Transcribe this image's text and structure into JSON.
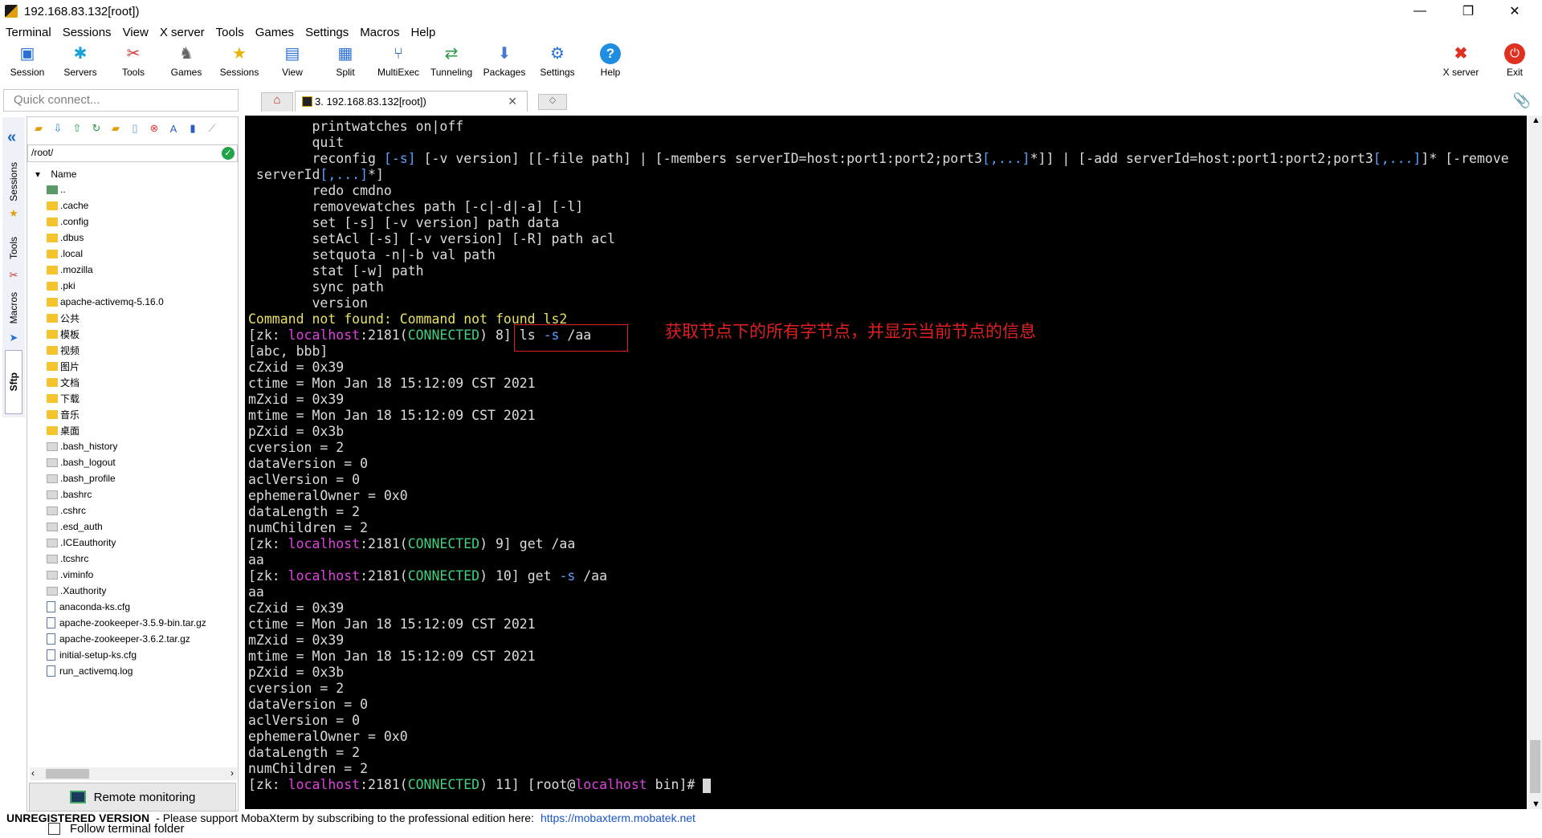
{
  "window": {
    "title": "192.168.83.132[root])",
    "controls": {
      "minimize": "—",
      "restore": "❐",
      "close": "✕"
    }
  },
  "menu": [
    "Terminal",
    "Sessions",
    "View",
    "X server",
    "Tools",
    "Games",
    "Settings",
    "Macros",
    "Help"
  ],
  "toolbar": {
    "items": [
      {
        "label": "Session",
        "icon": "session-icon"
      },
      {
        "label": "Servers",
        "icon": "servers-icon"
      },
      {
        "label": "Tools",
        "icon": "tools-icon"
      },
      {
        "label": "Games",
        "icon": "games-icon"
      },
      {
        "label": "Sessions",
        "icon": "star-icon"
      },
      {
        "label": "View",
        "icon": "view-icon"
      },
      {
        "label": "Split",
        "icon": "split-icon"
      },
      {
        "label": "MultiExec",
        "icon": "multiexec-icon"
      },
      {
        "label": "Tunneling",
        "icon": "tunneling-icon"
      },
      {
        "label": "Packages",
        "icon": "packages-icon"
      },
      {
        "label": "Settings",
        "icon": "settings-icon"
      },
      {
        "label": "Help",
        "icon": "help-icon"
      }
    ],
    "xserver": "X server",
    "exit": "Exit"
  },
  "quick_connect": {
    "placeholder": "Quick connect..."
  },
  "tabs": {
    "active": "3. 192.168.83.132[root])"
  },
  "side_tabs": [
    "Sessions",
    "Tools",
    "Macros",
    "Sftp"
  ],
  "sftp": {
    "path": "/root/",
    "column": "Name",
    "items": [
      {
        "name": "..",
        "type": "up"
      },
      {
        "name": ".cache",
        "type": "folder"
      },
      {
        "name": ".config",
        "type": "folder"
      },
      {
        "name": ".dbus",
        "type": "folder"
      },
      {
        "name": ".local",
        "type": "folder"
      },
      {
        "name": ".mozilla",
        "type": "folder"
      },
      {
        "name": ".pki",
        "type": "folder"
      },
      {
        "name": "apache-activemq-5.16.0",
        "type": "folder"
      },
      {
        "name": "公共",
        "type": "folder"
      },
      {
        "name": "模板",
        "type": "folder"
      },
      {
        "name": "视频",
        "type": "folder"
      },
      {
        "name": "图片",
        "type": "folder"
      },
      {
        "name": "文档",
        "type": "folder"
      },
      {
        "name": "下载",
        "type": "folder"
      },
      {
        "name": "音乐",
        "type": "folder"
      },
      {
        "name": "桌面",
        "type": "folder"
      },
      {
        "name": ".bash_history",
        "type": "file"
      },
      {
        "name": ".bash_logout",
        "type": "file"
      },
      {
        "name": ".bash_profile",
        "type": "file"
      },
      {
        "name": ".bashrc",
        "type": "file"
      },
      {
        "name": ".cshrc",
        "type": "file"
      },
      {
        "name": ".esd_auth",
        "type": "file"
      },
      {
        "name": ".ICEauthority",
        "type": "file"
      },
      {
        "name": ".tcshrc",
        "type": "file"
      },
      {
        "name": ".viminfo",
        "type": "file"
      },
      {
        "name": ".Xauthority",
        "type": "file"
      },
      {
        "name": "anaconda-ks.cfg",
        "type": "doc"
      },
      {
        "name": "apache-zookeeper-3.5.9-bin.tar.gz",
        "type": "doc"
      },
      {
        "name": "apache-zookeeper-3.6.2.tar.gz",
        "type": "doc"
      },
      {
        "name": "initial-setup-ks.cfg",
        "type": "doc"
      },
      {
        "name": "run_activemq.log",
        "type": "doc"
      }
    ],
    "remote_monitoring": "Remote monitoring",
    "follow_folder": "Follow terminal folder"
  },
  "terminal": {
    "lines": [
      [
        [
          "        printwatches on|off",
          ""
        ]
      ],
      [
        [
          "        quit",
          ""
        ]
      ],
      [
        [
          "        reconfig ",
          ""
        ],
        [
          "[-s]",
          "b"
        ],
        [
          " ",
          ""
        ],
        [
          "[-v",
          ""
        ],
        [
          " version] [[",
          ""
        ],
        [
          "-file",
          ""
        ],
        [
          " path] | [",
          ""
        ],
        [
          "-members",
          ""
        ],
        [
          " serverID=host:port1:port2;port3",
          ""
        ],
        [
          "[,...]",
          "b"
        ],
        [
          "*]] | [",
          ""
        ],
        [
          "-add",
          ""
        ],
        [
          " serverId=host:port1:port2;port3",
          ""
        ],
        [
          "[,...]",
          "b"
        ],
        [
          "]* [",
          ""
        ],
        [
          "-remove",
          ""
        ]
      ],
      [
        [
          " serverId",
          ""
        ],
        [
          "[,...]",
          "b"
        ],
        [
          "*]",
          ""
        ]
      ],
      [
        [
          "        redo cmdno",
          ""
        ]
      ],
      [
        [
          "        removewatches path [-c|-d|-a] [-l]",
          ""
        ]
      ],
      [
        [
          "        set ",
          ""
        ],
        [
          "[-s]",
          ""
        ],
        [
          " ",
          ""
        ],
        [
          "[-v",
          ""
        ],
        [
          " version] path data",
          ""
        ]
      ],
      [
        [
          "        setAcl ",
          ""
        ],
        [
          "[-s]",
          ""
        ],
        [
          " ",
          ""
        ],
        [
          "[-v",
          ""
        ],
        [
          " version] ",
          ""
        ],
        [
          "[-R]",
          ""
        ],
        [
          " path acl",
          ""
        ]
      ],
      [
        [
          "        setquota -n|-b val path",
          ""
        ]
      ],
      [
        [
          "        stat ",
          ""
        ],
        [
          "[-w]",
          ""
        ],
        [
          " path",
          ""
        ]
      ],
      [
        [
          "        sync path",
          ""
        ]
      ],
      [
        [
          "        version",
          ""
        ]
      ],
      [
        [
          "Command not found: Command not found ls2",
          "y"
        ]
      ],
      [
        [
          "[zk: ",
          ""
        ],
        [
          "localhost",
          "m"
        ],
        [
          ":2181(",
          ""
        ],
        [
          "CONNECTED",
          "g"
        ],
        [
          ") 8] ls ",
          ""
        ],
        [
          "-s",
          "b"
        ],
        [
          " /aa",
          ""
        ]
      ],
      [
        [
          "[abc, bbb]",
          ""
        ]
      ],
      [
        [
          "cZxid = 0x39",
          ""
        ]
      ],
      [
        [
          "ctime = Mon Jan 18 15:12:09 CST 2021",
          ""
        ]
      ],
      [
        [
          "mZxid = 0x39",
          ""
        ]
      ],
      [
        [
          "mtime = Mon Jan 18 15:12:09 CST 2021",
          ""
        ]
      ],
      [
        [
          "pZxid = 0x3b",
          ""
        ]
      ],
      [
        [
          "cversion = 2",
          ""
        ]
      ],
      [
        [
          "dataVersion = 0",
          ""
        ]
      ],
      [
        [
          "aclVersion = 0",
          ""
        ]
      ],
      [
        [
          "ephemeralOwner = 0x0",
          ""
        ]
      ],
      [
        [
          "dataLength = 2",
          ""
        ]
      ],
      [
        [
          "numChildren = 2",
          ""
        ]
      ],
      [
        [
          "[zk: ",
          ""
        ],
        [
          "localhost",
          "m"
        ],
        [
          ":2181(",
          ""
        ],
        [
          "CONNECTED",
          "g"
        ],
        [
          ") 9] get /aa",
          ""
        ]
      ],
      [
        [
          "aa",
          ""
        ]
      ],
      [
        [
          "[zk: ",
          ""
        ],
        [
          "localhost",
          "m"
        ],
        [
          ":2181(",
          ""
        ],
        [
          "CONNECTED",
          "g"
        ],
        [
          ") 10] get ",
          ""
        ],
        [
          "-s",
          "b"
        ],
        [
          " /aa",
          ""
        ]
      ],
      [
        [
          "aa",
          ""
        ]
      ],
      [
        [
          "cZxid = 0x39",
          ""
        ]
      ],
      [
        [
          "ctime = Mon Jan 18 15:12:09 CST 2021",
          ""
        ]
      ],
      [
        [
          "mZxid = 0x39",
          ""
        ]
      ],
      [
        [
          "mtime = Mon Jan 18 15:12:09 CST 2021",
          ""
        ]
      ],
      [
        [
          "pZxid = 0x3b",
          ""
        ]
      ],
      [
        [
          "cversion = 2",
          ""
        ]
      ],
      [
        [
          "dataVersion = 0",
          ""
        ]
      ],
      [
        [
          "aclVersion = 0",
          ""
        ]
      ],
      [
        [
          "ephemeralOwner = 0x0",
          ""
        ]
      ],
      [
        [
          "dataLength = 2",
          ""
        ]
      ],
      [
        [
          "numChildren = 2",
          ""
        ]
      ],
      [
        [
          "[zk: ",
          ""
        ],
        [
          "localhost",
          "m"
        ],
        [
          ":2181(",
          ""
        ],
        [
          "CONNECTED",
          "g"
        ],
        [
          ") 11] [root@",
          ""
        ],
        [
          "localhost",
          "m"
        ],
        [
          " bin]# ",
          ""
        ]
      ]
    ]
  },
  "annotation": "获取节点下的所有字节点，并显示当前节点的信息",
  "status": {
    "unregistered": "UNREGISTERED VERSION",
    "message": "-  Please support MobaXterm by subscribing to the professional edition here:",
    "link": "https://mobaxterm.mobatek.net"
  },
  "colors": {
    "terminal_bg": "#000000",
    "keyword_blue": "#5aa0ff",
    "host_magenta": "#e040e0",
    "connected_green": "#40d080",
    "warning_yellow": "#e8e060",
    "annotation_red": "#e02020"
  }
}
